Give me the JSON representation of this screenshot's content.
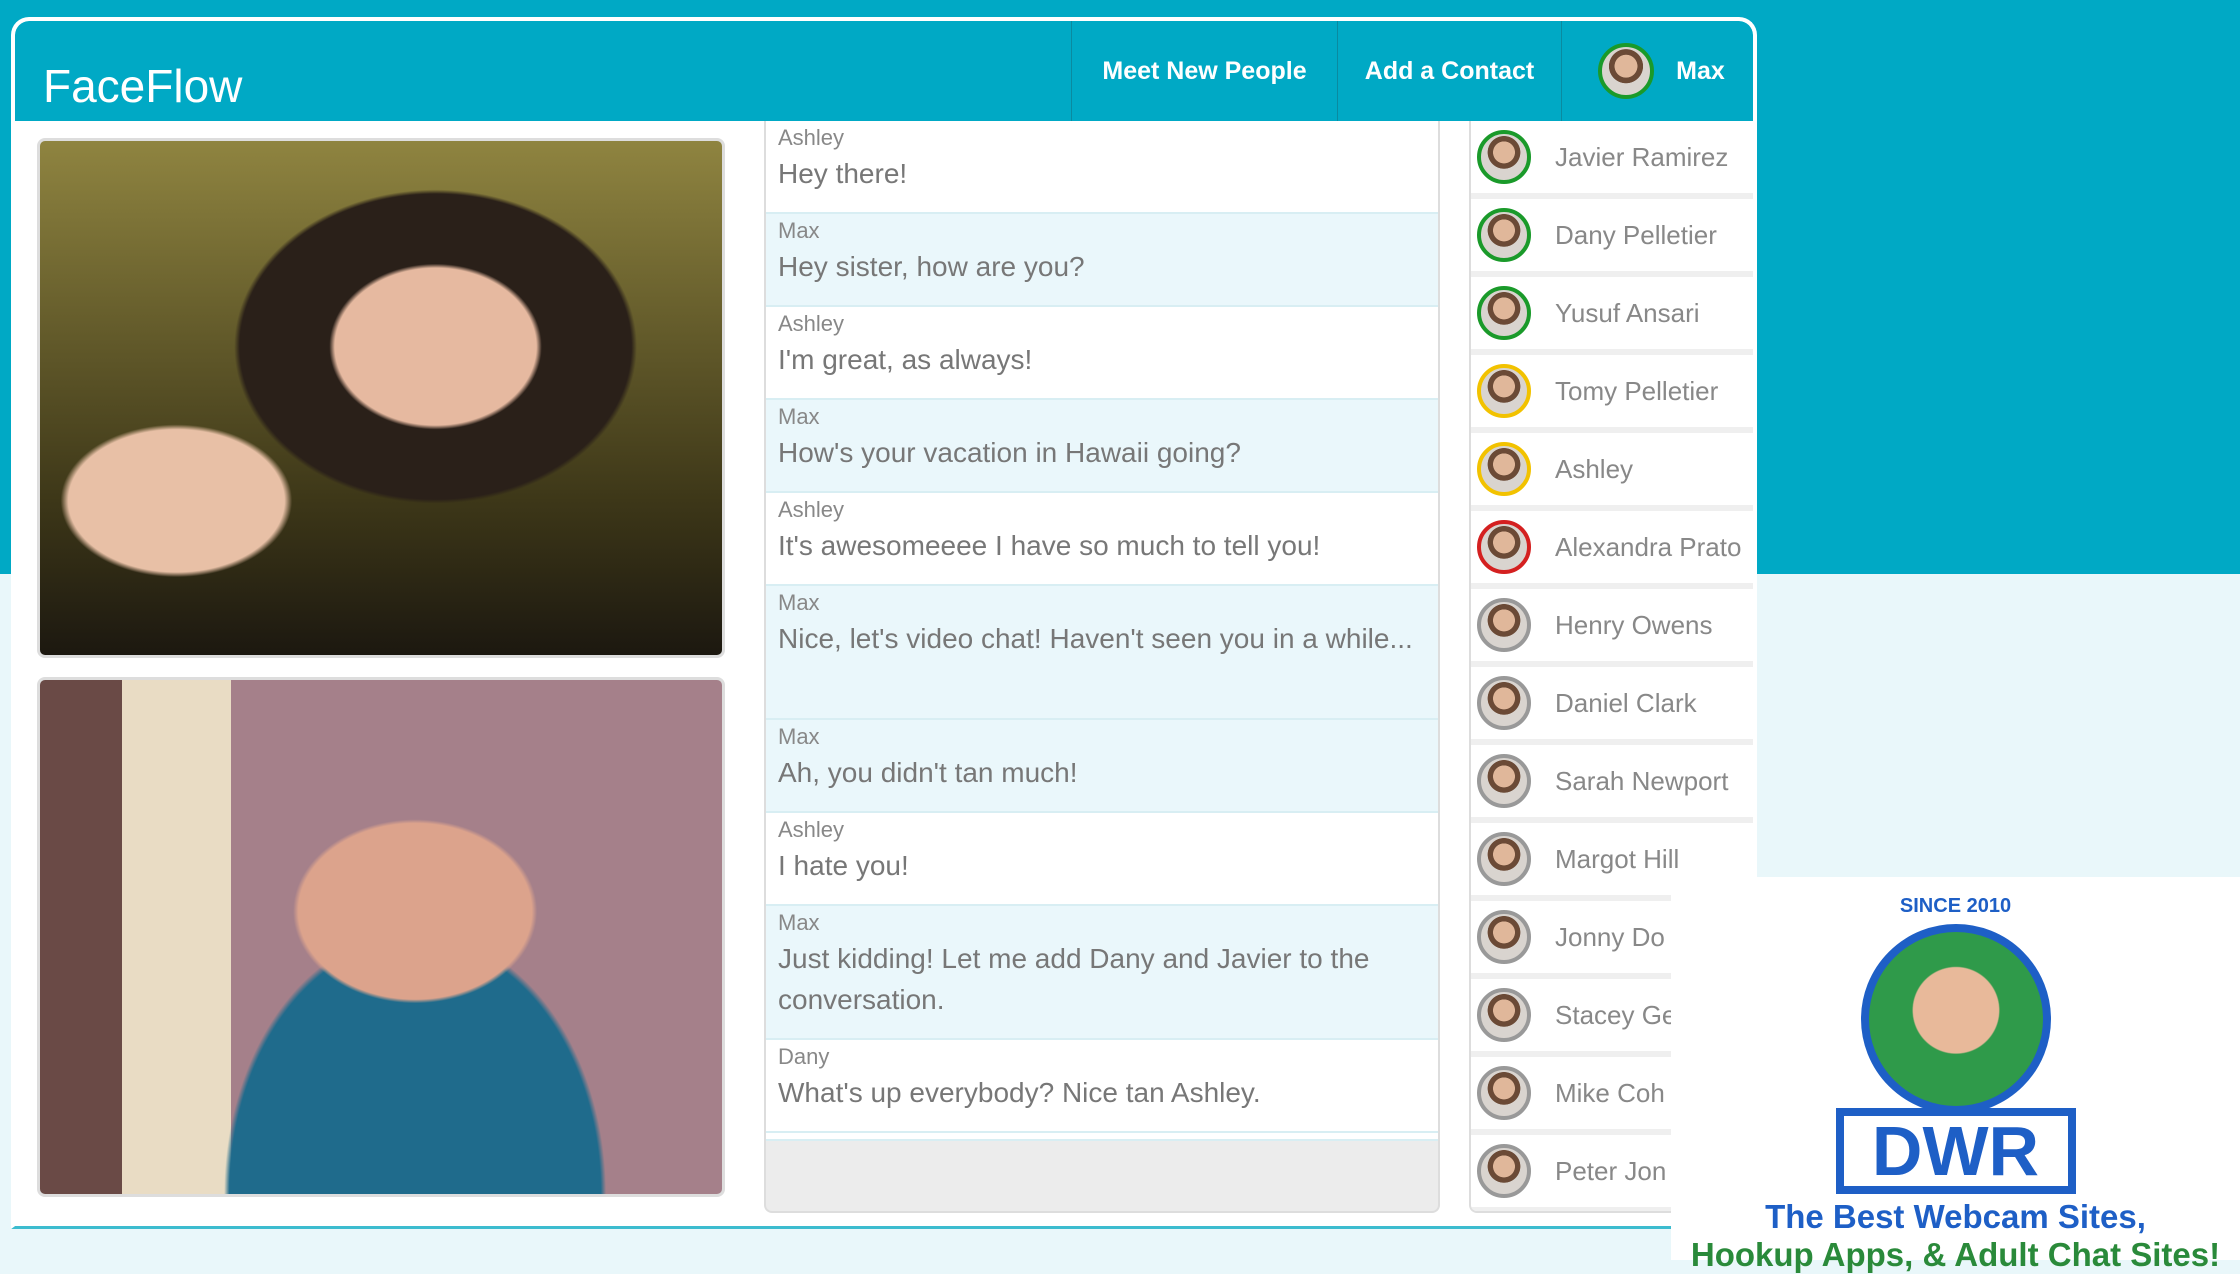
{
  "app": {
    "title": "FaceFlow"
  },
  "nav": {
    "meet": "Meet New People",
    "add": "Add a Contact",
    "user": "Max"
  },
  "messages": [
    {
      "from": "Ashley",
      "text": "Hey there!"
    },
    {
      "from": "Max",
      "text": "Hey sister, how are you?"
    },
    {
      "from": "Ashley",
      "text": "I'm great, as always!"
    },
    {
      "from": "Max",
      "text": "How's your vacation in Hawaii going?"
    },
    {
      "from": "Ashley",
      "text": "It's awesomeeee I have so much to tell you!"
    },
    {
      "from": "Max",
      "text": "Nice, let's video chat! Haven't seen you in a while..."
    },
    {
      "from": "Max",
      "text": "Ah, you didn't tan much!"
    },
    {
      "from": "Ashley",
      "text": "I hate you!"
    },
    {
      "from": "Max",
      "text": "Just kidding! Let me add Dany and Javier to the conversation."
    },
    {
      "from": "Dany",
      "text": "What's up everybody? Nice tan Ashley."
    }
  ],
  "contacts": [
    {
      "name": "Javier Ramirez",
      "status": "#1a9a2a"
    },
    {
      "name": "Dany Pelletier",
      "status": "#1a9a2a"
    },
    {
      "name": "Yusuf Ansari",
      "status": "#1a9a2a"
    },
    {
      "name": "Tomy Pelletier",
      "status": "#f2c200"
    },
    {
      "name": "Ashley",
      "status": "#f2c200"
    },
    {
      "name": "Alexandra Prato",
      "status": "#d42020"
    },
    {
      "name": "Henry Owens",
      "status": "#999999"
    },
    {
      "name": "Daniel Clark",
      "status": "#999999"
    },
    {
      "name": "Sarah Newport",
      "status": "#999999"
    },
    {
      "name": "Margot Hill",
      "status": "#999999"
    },
    {
      "name": "Jonny Do",
      "status": "#999999"
    },
    {
      "name": "Stacey Ge",
      "status": "#999999"
    },
    {
      "name": "Mike Coh",
      "status": "#999999"
    },
    {
      "name": "Peter Jon",
      "status": "#999999"
    }
  ],
  "watermark": {
    "since": "SINCE 2010",
    "brand": "DWR",
    "line1": "The Best Webcam Sites,",
    "line2": "Hookup Apps, & Adult Chat Sites!"
  }
}
